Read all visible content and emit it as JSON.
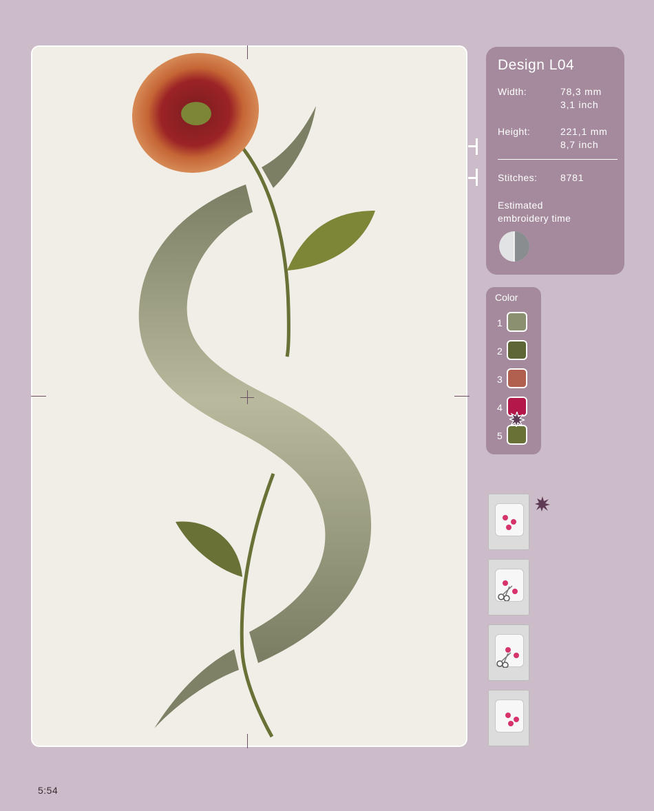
{
  "design": {
    "title": "Design L04",
    "width_label": "Width:",
    "width_mm": "78,3 mm",
    "width_inch": "3,1 inch",
    "height_label": "Height:",
    "height_mm": "221,1 mm",
    "height_inch": "8,7 inch",
    "stitches_label": "Stitches:",
    "stitches_value": "8781",
    "time_label_line1": "Estimated",
    "time_label_line2": "embroidery time",
    "time_icon": "clock-half-icon"
  },
  "colors": {
    "title": "Color",
    "items": [
      {
        "num": "1",
        "hex": "#8b9070"
      },
      {
        "num": "2",
        "hex": "#5f6636"
      },
      {
        "num": "3",
        "hex": "#b1604f"
      },
      {
        "num": "4",
        "hex": "#b4174a"
      },
      {
        "num": "5",
        "hex": "#6a7136"
      }
    ],
    "marked_item": "4"
  },
  "hoop_steps": [
    {
      "icon": "hoop-stabilizer-icon",
      "marked": true
    },
    {
      "icon": "hoop-cutting-icon",
      "marked": false
    },
    {
      "icon": "hoop-scissors-icon",
      "marked": false
    },
    {
      "icon": "hoop-finished-icon",
      "marked": false
    }
  ],
  "page_number": "5:54"
}
